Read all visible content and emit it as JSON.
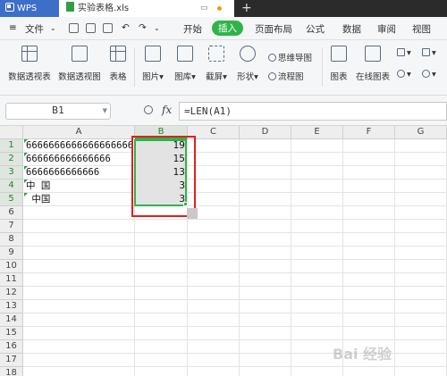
{
  "titlebar": {
    "app_name": "WPS",
    "doc_name": "实验表格.xls",
    "new_tab": "+"
  },
  "menubar": {
    "file": "文件",
    "items": [
      "开始",
      "插入",
      "页面布局",
      "公式",
      "数据",
      "审阅",
      "视图"
    ],
    "active": "插入"
  },
  "ribbon": {
    "pivot_table": "数据透视表",
    "pivot_chart": "数据透视图",
    "table": "表格",
    "picture": "图片",
    "gallery": "图库",
    "screenshot": "截屏",
    "shapes": "形状",
    "mind_map": "思维导图",
    "flowchart": "流程图",
    "chart": "图表",
    "online_chart": "在线图表"
  },
  "formula_bar": {
    "name_box": "B1",
    "fx": "fx",
    "formula": "=LEN(A1)"
  },
  "sheet": {
    "columns": [
      "A",
      "B",
      "C",
      "D",
      "E",
      "F",
      "G"
    ],
    "rows": [
      "1",
      "2",
      "3",
      "4",
      "5",
      "6",
      "7",
      "8",
      "9",
      "10",
      "11",
      "12",
      "13",
      "14",
      "15",
      "16",
      "17",
      "18"
    ],
    "col_a": [
      "6666666666666666666",
      "666666666666666",
      "6666666666666",
      "中 国",
      " 中国"
    ],
    "col_b": [
      "19",
      "15",
      "13",
      "3",
      "3"
    ]
  },
  "watermark": "Bai 经验"
}
